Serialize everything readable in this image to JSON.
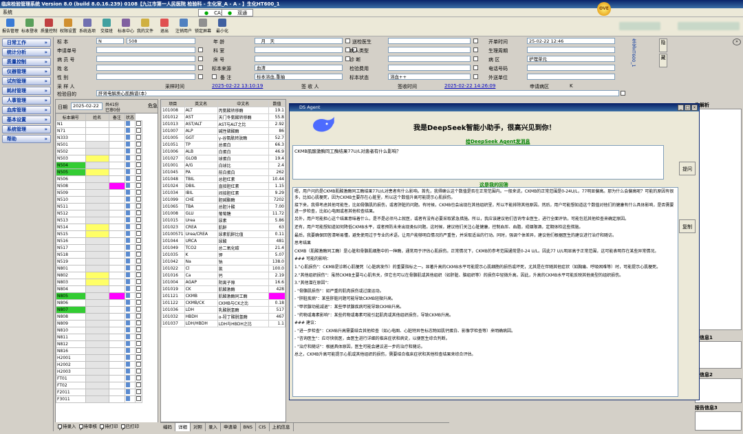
{
  "title": "临床检验管理系统 Version 8.0 (build 8.0.16.239) 0108【九江市第一人民医院 检验科 - 生化室_A - A - 】生化HT600_1",
  "menu": {
    "system": "系统",
    "tab_ca": "CA关",
    "tab_dual": "双通"
  },
  "toolbar": [
    {
      "label": "报告管理",
      "icon": "report-icon",
      "color": "#3a7bd5"
    },
    {
      "label": "标本登收",
      "icon": "specimen-icon",
      "color": "#5aa05a"
    },
    {
      "label": "质量控制",
      "icon": "qc-icon",
      "color": "#c04040"
    },
    {
      "label": "权限设置",
      "icon": "permission-icon",
      "color": "#d09030"
    },
    {
      "label": "系统选项",
      "icon": "options-icon",
      "color": "#7070b0"
    },
    {
      "label": "交接班",
      "icon": "handover-icon",
      "color": "#40a0a0"
    },
    {
      "label": "标本中心",
      "icon": "center-icon",
      "color": "#8060a0"
    },
    {
      "label": "我的文件",
      "icon": "file-icon",
      "color": "#d0b040"
    },
    {
      "label": "退出",
      "icon": "exit-icon",
      "color": "#e05050"
    },
    {
      "label": "注销用户",
      "icon": "logout-icon",
      "color": "#5080c0"
    },
    {
      "label": "锁定屏幕",
      "icon": "lock-icon",
      "color": "#909090"
    },
    {
      "label": "最小化",
      "icon": "minimize-icon",
      "color": "#4060a0"
    }
  ],
  "ove": "OVE",
  "sidebar": [
    "日常工作",
    "统计分析",
    "质量控制",
    "仪器管理",
    "试剂管理",
    "耗材管理",
    "人事管理",
    "血库管理",
    "基本设置",
    "系统管理",
    "帮助"
  ],
  "form": {
    "specimen_label": "标 本",
    "specimen_type": "N",
    "specimen_no": "508",
    "apply_no_label": "申请单号",
    "patient_no_label": "病 员 号",
    "name_label": "姓 名",
    "sex_label": "性 别",
    "age_label": "年 龄",
    "age_value": "__月__天",
    "dept_label": "科 室",
    "bed_label": "床 号",
    "specimen_source_label": "标本来源",
    "specimen_source": "血清",
    "remark_label": "备 注",
    "remark": "标本溶血,重抽",
    "doctor_label": "送检医生",
    "patient_type_label": "病人类型",
    "diagnosis_label": "诊 断",
    "check_fee_label": "检验费用",
    "specimen_status_label": "标本状态",
    "specimen_status": "溶血++",
    "time_label": "开单时间",
    "time_value": "25-02-22 12:46",
    "cycle_label": "生理周期",
    "ward_label": "病 区",
    "ward_value": "护理单元",
    "phone_label": "电话号码",
    "outside_label": "外送单位",
    "collector_label": "采 样 人",
    "collect_time_label": "采样时间",
    "collect_time": "2025-02-22 13:10:19",
    "receiver_label": "签 收 人",
    "sign_time_label": "签收时间",
    "sign_time": "2025-02-22 14:26:09",
    "apply_ward_label": "申请病区",
    "apply_ward": "K",
    "purpose_label": "检验目的",
    "purpose": "肝肾电解质心肌酶谱(本)",
    "side_text": "生化HT600_1",
    "btn1": "隐",
    "btn2": "藏"
  },
  "list": {
    "date_label": "日期",
    "date": "2025-02-22",
    "count_text": "共41份",
    "done_text": "已审0份",
    "col_no": "标本编号",
    "col_name": "姓名",
    "col_remark": "备注",
    "col_status": "状态",
    "col_crit": "危急",
    "rows": [
      "N1",
      "N71",
      "N333",
      "N501",
      "N502",
      "N503",
      "N504",
      "N505",
      "N506",
      "N508",
      "N509",
      "N510",
      "N511",
      "N512",
      "N513",
      "N514",
      "N515",
      "N516",
      "N517",
      "N518",
      "N519",
      "N801",
      "N802",
      "N803",
      "N804",
      "N805",
      "N806",
      "N807",
      "N808",
      "N809",
      "N810",
      "N811",
      "N812",
      "N816",
      "H2001",
      "H2002",
      "H2003",
      "FT01",
      "FT02",
      "F2011",
      "F3011"
    ],
    "footer": [
      "待录入",
      "待审核",
      "待打印",
      "已打印"
    ]
  },
  "results": {
    "headers": [
      "项目",
      "英文名",
      "中文名",
      "数值"
    ],
    "rows": [
      [
        "101008",
        "ALT",
        "丙氨酸转移酶",
        "19.1"
      ],
      [
        "101012",
        "AST",
        "天门冬氨酸转移酶",
        "55.8"
      ],
      [
        "101013",
        "AST/ALT",
        "AST与ALT之比",
        "2.92"
      ],
      [
        "101007",
        "ALP",
        "碱性磷酸酶",
        "86"
      ],
      [
        "101005",
        "GGT",
        "γ-谷氨酰转肽酶",
        "52.7"
      ],
      [
        "101051",
        "TP",
        "总蛋白",
        "66.3"
      ],
      [
        "101006",
        "ALB",
        "白蛋白",
        "46.9"
      ],
      [
        "101027",
        "GLOB",
        "球蛋白",
        "19.4"
      ],
      [
        "101001",
        "A/G",
        "白球比",
        "2.4"
      ],
      [
        "101045",
        "PA",
        "前白蛋白",
        "262"
      ],
      [
        "101048",
        "TBIL",
        "总胆红素",
        "10.44"
      ],
      [
        "101024",
        "DBIL",
        "直接胆红素",
        "1.15"
      ],
      [
        "101034",
        "IBIL",
        "间接胆红素",
        "9.29"
      ],
      [
        "101099",
        "CHE",
        "胆碱酯酶",
        "7202"
      ],
      [
        "101065",
        "TBA",
        "总胆汁酸",
        "7.00"
      ],
      [
        "101008",
        "GLU",
        "葡萄糖",
        "11.72"
      ],
      [
        "101015",
        "Urea",
        "尿素",
        "5.86"
      ],
      [
        "101023",
        "CREA",
        "肌酐",
        "63"
      ],
      [
        "10100571",
        "Urea/CREA",
        "尿素肌酐比值",
        "0.11"
      ],
      [
        "101044",
        "URCA",
        "尿酸",
        "481"
      ],
      [
        "101049",
        "TCO2",
        "总二氧化碳",
        "21.4"
      ],
      [
        "101035",
        "K",
        "钾",
        "5.07"
      ],
      [
        "101042",
        "Na",
        "钠",
        "138.0"
      ],
      [
        "101022",
        "Cl",
        "氯",
        "100.0"
      ],
      [
        "101016",
        "Ca",
        "钙",
        "2.19"
      ],
      [
        "101004",
        "AGAP",
        "阴离子隙",
        "16.6"
      ],
      [
        "101019",
        "CK",
        "肌酸激酶",
        "428"
      ],
      [
        "101121",
        "CKMB",
        "肌酸激酶同工酶",
        "77"
      ],
      [
        "101122",
        "CKMB/CK",
        "CKMB与CK之比",
        "0.18"
      ],
      [
        "101036",
        "LDH",
        "乳酸脱氢酶",
        "517"
      ],
      [
        "101032",
        "HBDH",
        "α-羟丁酸脱氢酶",
        "467"
      ],
      [
        "101037",
        "LDH/HBDH",
        "LDH与HBDH之比",
        "1.1"
      ]
    ]
  },
  "bottom_tabs": [
    "编码",
    "详细",
    "对照",
    "录入",
    "申请单",
    "BNS",
    "CIS",
    "上机信息"
  ],
  "ds": {
    "title": "DS Agent",
    "greeting": "我是DeepSeek智能小助手，很高兴见到你！",
    "send_label": "给DeepSeek Agent发消息",
    "question": "CKMB肌酸激酶同工酶结果77U/L对患者有什么影响？",
    "ask_btn": "提问",
    "answer_label": "这是我的回答",
    "copy_btn": "复制",
    "answer": [
      "嗯，用户问的是CKMB肌酸激酶同工酶结果77U/L对患者有什么影响。首先，我得确认这个数值是否在正常范围内。一般来说，CKMB的正常范围是0-24U/L，77明显偏高。那为什么会偏高呢？可能的原因有很多，比如心肌梗死，因为CKMB主要存在心脏里，所以这个数值升高可能提示心肌损伤。",
      "接下来，我得考虑其他可能性，比如骨骼肌的损伤，或者肝脏的问题。有时候，CKMB也会出现在其他组织里，所以不能排除其他原因。然后，用户可能想知道这个数值对他们的健康有什么具体影响，是否需要进一步检查，比如心电图或者其他检查结果。",
      "另外，用户可能担心这个结果意味着什么，是不是必须马上就医，或者有没有必要采取紧急措施。所以，我应该建议他们咨询专业医生，进行全面评估，可能包括其他检查来确定原因。",
      "还有，用户可能想知道如何降低CKMB水平，或者预防未来出现类似问题。这时候，建议他们关注心脏健康，控制血压、血脂，戒烟限酒，定期体检这些措施。",
      "最后，我要确保回答清晰易懂，避免使用过于专业的术语，让用户能够明白情况的严重性，并采取适当的行动。同时，强调个体差异，建议他们根据医生的建议进行治疗和随访。",
      "思考结果",
      "CKMB（肌酸激酶同工酶）是心脏和骨骼肌细胞中的一种酶，通常用于评估心肌损伤。正常情况下，CKMB的参考范围通常是0-24 U/L。因此77 U/L明显高于正常范围，这可能表明存在某些异常情况。",
      "### 可能的影响：",
      "1.\"心肌损伤\"：CKMB是诊断心肌梗死（心脏病发作）的重要指标之一。显著升高的CKMB水平可能提示心肌细胞的损伤或坏死，尤其是在伴随其他症状（如胸痛、呼吸困难等）时，可能提示心肌梗死。",
      "2.\"其他组织损伤\"：虽然CKMB主要与心肌有关，但它也可以在骨骼肌或其他组织（如肝脏、脑组织等）的损伤中轻微升高。因此，升高的CKMB水平可能反映其他类型的组织损伤。",
      "3.\"其他潜在原因\"：",
      "- \"骨骼肌损伤\"：如严重的肌肉损伤或过度运动。",
      "- \"肝脏疾病\"：某些肝脏问题可能导致CKMB轻微升高。",
      "- \"甲状腺功能减退\"：某些甲状腺疾病可能导致CKMB升高。",
      "- \"药物或毒素影响\"：某些药物或毒素可能引起肌肉或其他组织损伤，导致CKMB升高。",
      "### 建议：",
      "- \"进一步检查\"：CKMB升高需要结合其他检查（如心电图、心脏特异性标志物如肌钙蛋白、影像学检查等）来明确病因。",
      "- \"咨询医生\"：应尽快就医，由医生进行详细的临床症状和病史，以便医生综合判断。",
      "- \"治疗和随访\"：根据具体原因，医生可能会建议进一步的治疗和随访。",
      "总之，CKMB升高可能提示心肌或其他组织的损伤，需要结合临床症状和其他检查结果来综合评估。"
    ]
  },
  "right": {
    "label1": "告解析",
    "label2": "告信息1",
    "label3": "告信息2",
    "label4": "报告信息3"
  }
}
